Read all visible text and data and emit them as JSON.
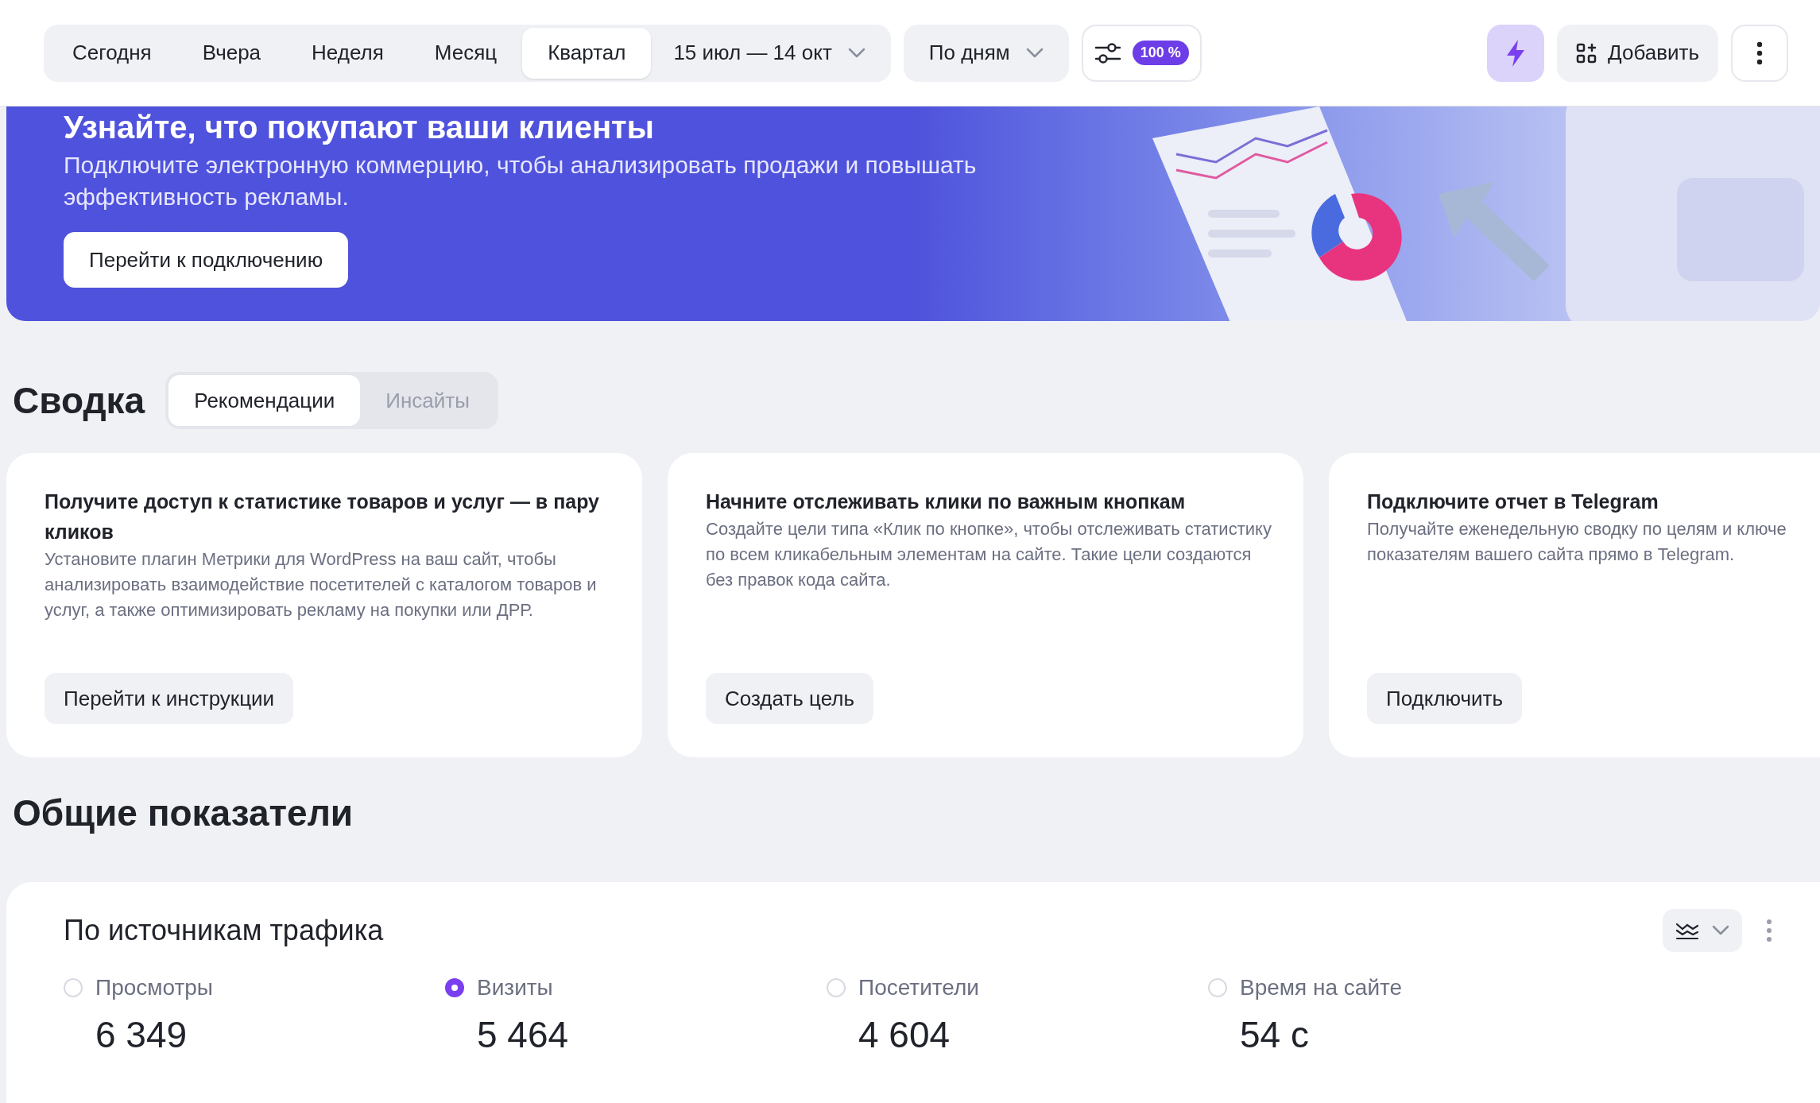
{
  "toolbar": {
    "periods": [
      {
        "label": "Сегодня",
        "selected": false
      },
      {
        "label": "Вчера",
        "selected": false
      },
      {
        "label": "Неделя",
        "selected": false
      },
      {
        "label": "Месяц",
        "selected": false
      },
      {
        "label": "Квартал",
        "selected": true
      }
    ],
    "date_range": "15 июл — 14 окт",
    "grouping": "По дням",
    "sampling_badge": "100 %",
    "add_button": "Добавить"
  },
  "banner": {
    "title": "Узнайте, что покупают ваши клиенты",
    "text": "Подключите электронную коммерцию, чтобы анализировать продажи и повышать эффективность рекламы.",
    "button": "Перейти к подключению"
  },
  "summary": {
    "title": "Сводка",
    "tabs": [
      {
        "label": "Рекомендации",
        "selected": true
      },
      {
        "label": "Инсайты",
        "selected": false
      }
    ],
    "cards": [
      {
        "title": "Получите доступ к статистике товаров и услуг — в пару кликов",
        "text": "Установите плагин Метрики для WordPress на ваш сайт, чтобы анализировать взаимодействие посетителей с каталогом товаров и услуг, а также оптимизировать рекламу на покупки или ДРР.",
        "button": "Перейти к инструкции"
      },
      {
        "title": "Начните отслеживать клики по важным кнопкам",
        "text": "Создайте цели типа «Клик по кнопке», чтобы отслеживать статистику по всем кликабельным элементам на сайте. Такие цели создаются без правок кода сайта.",
        "button": "Создать цель"
      },
      {
        "title": "Подключите отчет в Telegram",
        "text": "Получайте еженедельную сводку по целям и ключе показателям вашего сайта прямо в Telegram.",
        "button": "Подключить"
      }
    ]
  },
  "overview": {
    "title": "Общие показатели",
    "widget": {
      "title": "По источникам трафика",
      "metrics": [
        {
          "label": "Просмотры",
          "value": "6 349",
          "selected": false
        },
        {
          "label": "Визиты",
          "value": "5 464",
          "selected": true
        },
        {
          "label": "Посетители",
          "value": "4 604",
          "selected": false
        },
        {
          "label": "Время на сайте",
          "value": "54 с",
          "selected": false
        }
      ]
    }
  }
}
